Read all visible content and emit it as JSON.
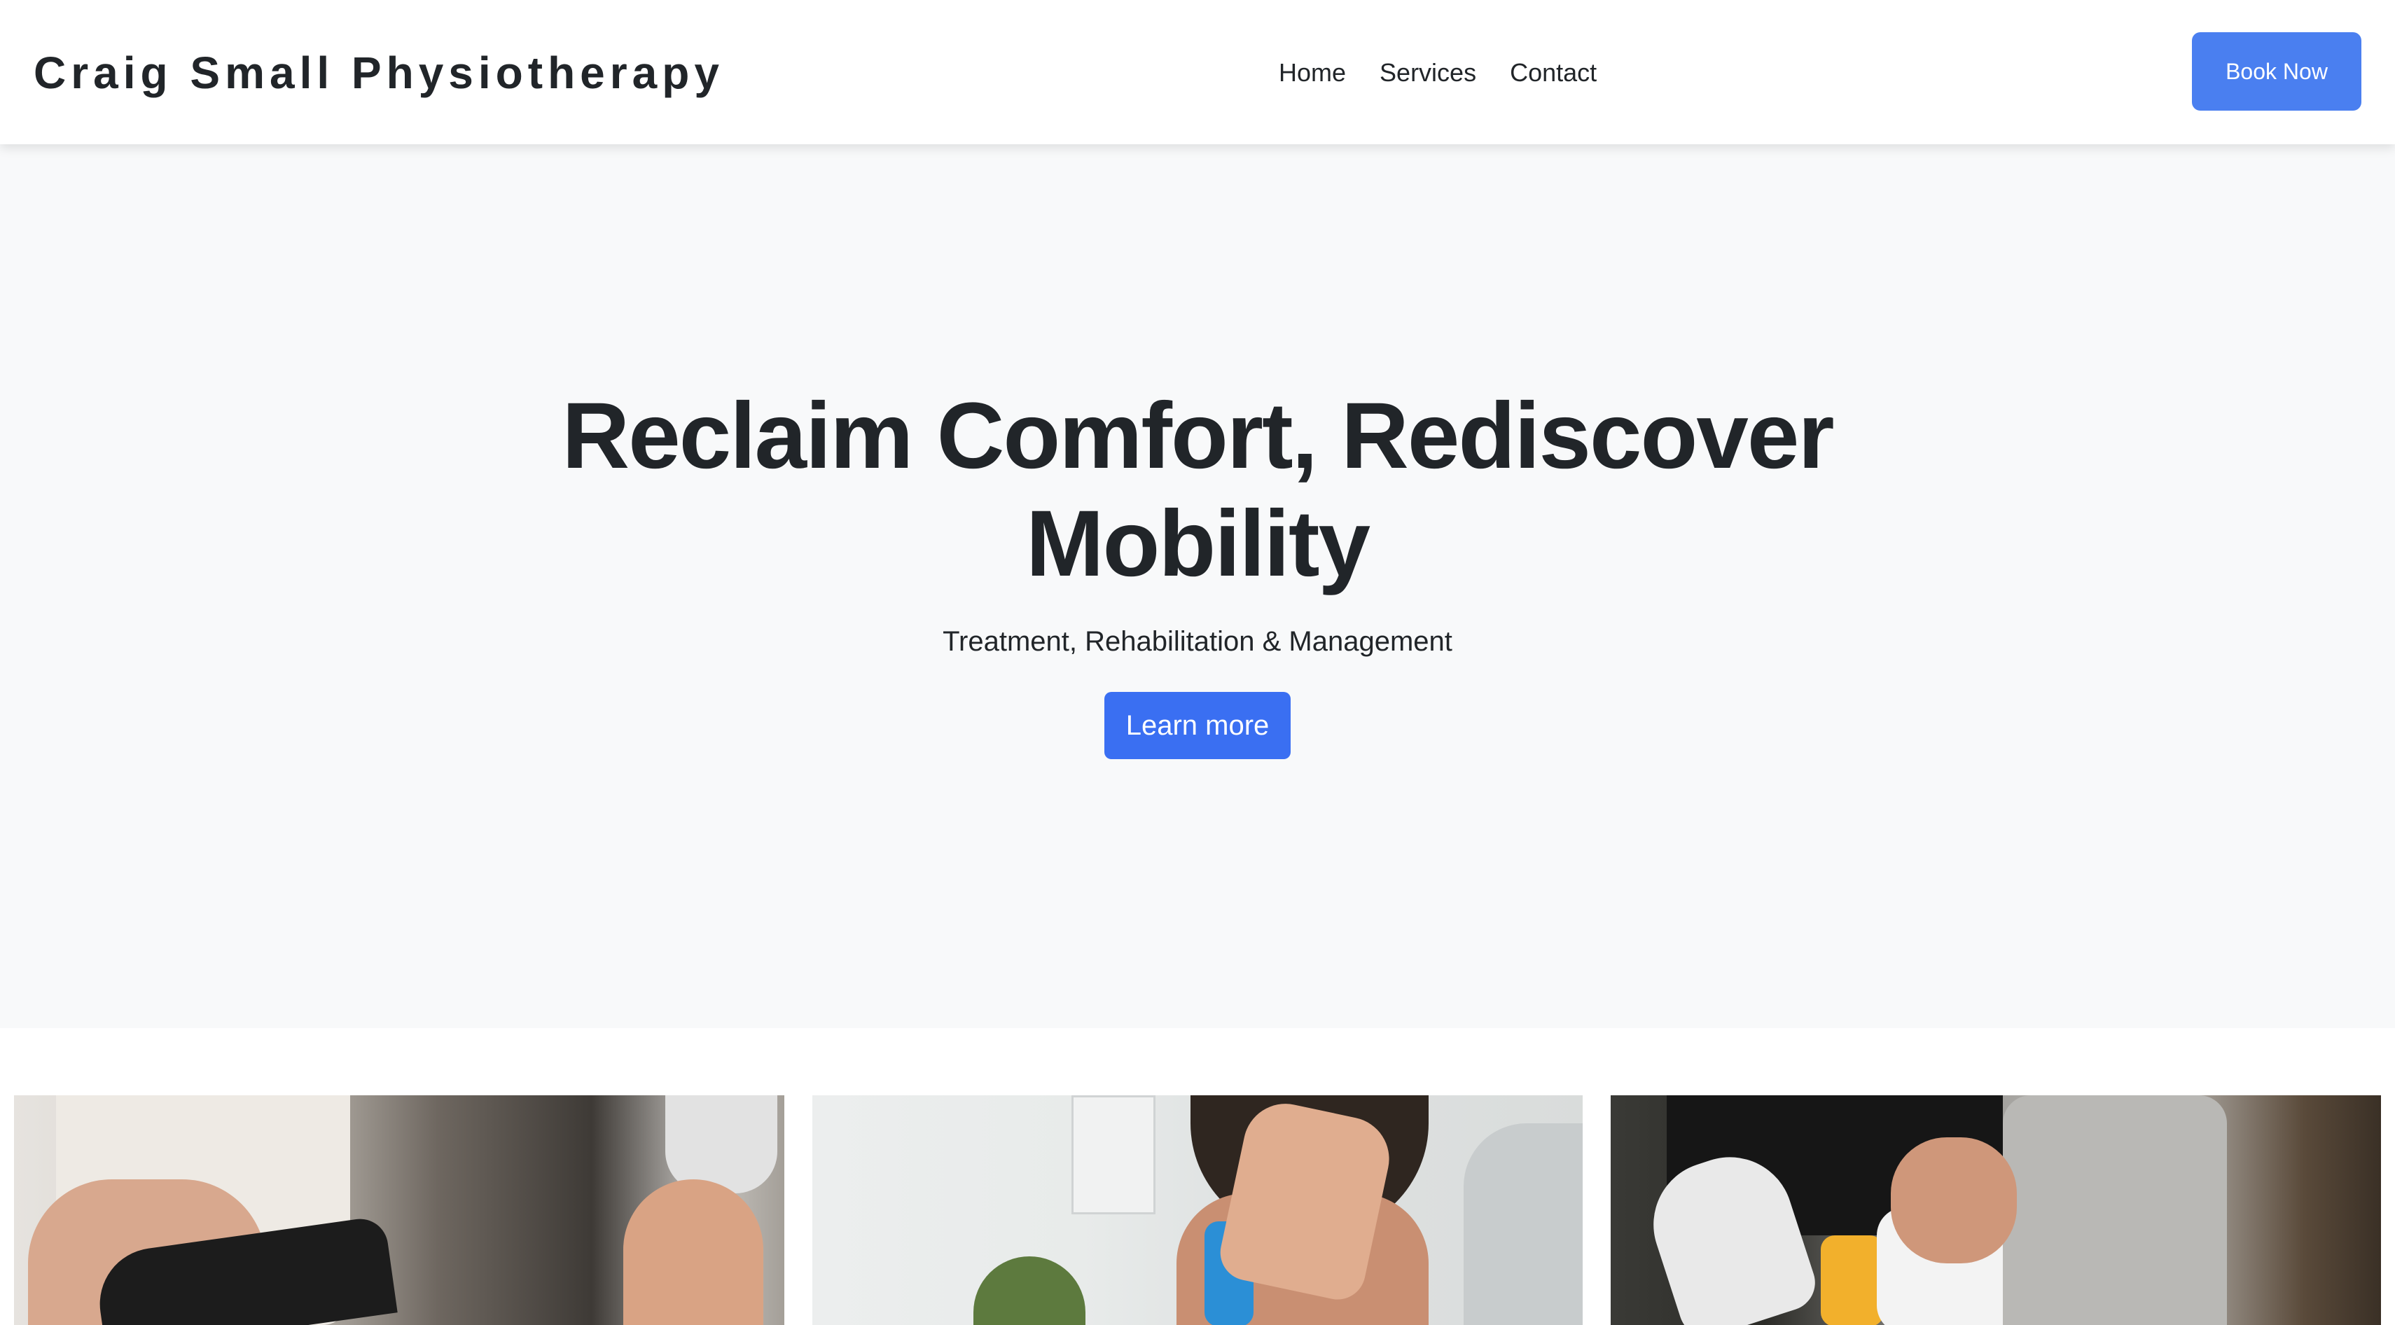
{
  "header": {
    "brand": "Craig Small Physiotherapy",
    "nav": [
      {
        "label": "Home"
      },
      {
        "label": "Services"
      },
      {
        "label": "Contact"
      }
    ],
    "cta_label": "Book Now"
  },
  "hero": {
    "title": "Reclaim Comfort, Rediscover Mobility",
    "subtitle": "Treatment, Rehabilitation & Management",
    "button_label": "Learn more"
  },
  "colors": {
    "accent": "#3a6ff2",
    "book_button": "#4a7ff0",
    "hero_background": "#f8f9fa",
    "text": "#212529"
  }
}
